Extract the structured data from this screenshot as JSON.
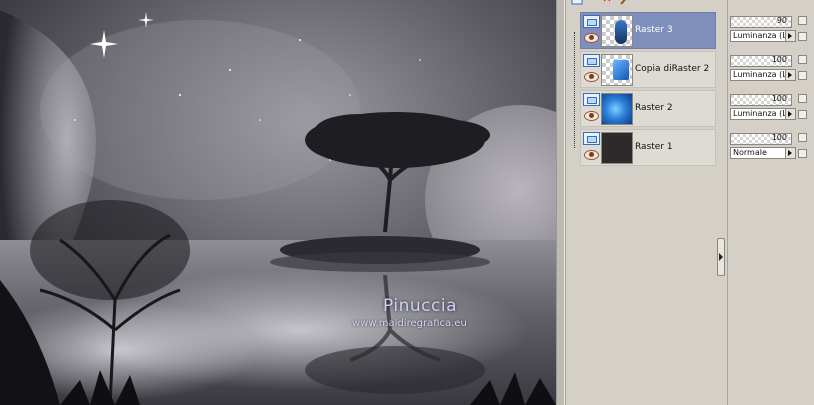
{
  "canvas": {
    "watermark_name": "Pinuccia",
    "watermark_url": "www.maidiregrafica.eu"
  },
  "layers": [
    {
      "name": "Raster 3",
      "selected": true,
      "thumb": "raster3-thumb",
      "opacity": "90",
      "blend_mode": "Luminanza (L)"
    },
    {
      "name": "Copia diRaster 2",
      "selected": false,
      "thumb": "copy-raster2-thumb",
      "opacity": "100",
      "blend_mode": "Luminanza (L)"
    },
    {
      "name": "Raster 2",
      "selected": false,
      "thumb": "raster2-thumb",
      "opacity": "100",
      "blend_mode": "Luminanza (L)"
    },
    {
      "name": "Raster 1",
      "selected": false,
      "thumb": "raster1-thumb",
      "opacity": "100",
      "blend_mode": "Normale"
    }
  ],
  "icons": {
    "new_layer": "new-layer-icon",
    "delete_layer": "delete-layer-icon",
    "layer_type": "raster-layer-icon",
    "visibility": "eye-icon",
    "expand_panel": "expand-arrow-icon",
    "blend_dropdown": "chevron-right-icon"
  },
  "colors": {
    "selection": "#7d8fba",
    "panel_bg": "#d4d0c8",
    "delete_red": "#cc1111"
  }
}
